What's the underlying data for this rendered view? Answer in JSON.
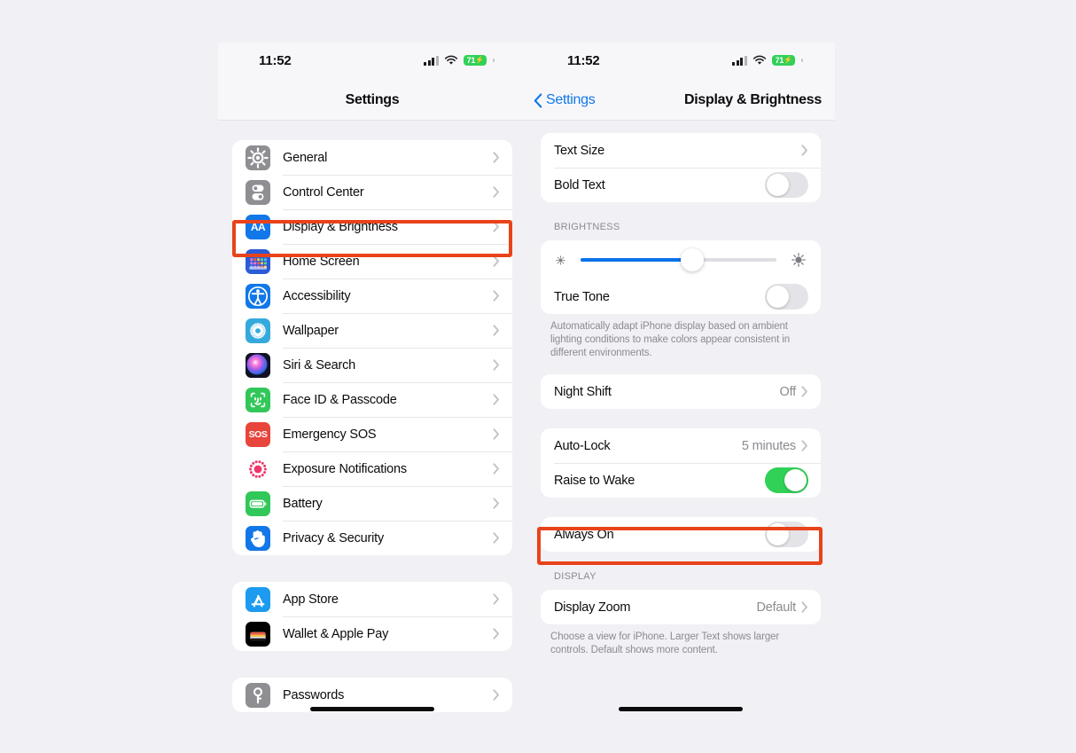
{
  "status_bar": {
    "time": "11:52",
    "battery_level": "71",
    "battery_charging_glyph": "⚡",
    "signal_icon": "cellular-bars-icon",
    "wifi_icon": "wifi-icon",
    "battery_icon": "battery-icon"
  },
  "left_panel": {
    "nav_title": "Settings",
    "groups": [
      {
        "rows": [
          {
            "label": "General",
            "icon": "gear-icon",
            "icon_bg": "#8E8E93",
            "accessory": "chevron"
          },
          {
            "label": "Control Center",
            "icon": "control-center-icon",
            "icon_bg": "#8E8E93",
            "accessory": "chevron"
          },
          {
            "label": "Display & Brightness",
            "icon": "display-brightness-icon",
            "icon_bg": "#1277E8",
            "accessory": "chevron",
            "highlighted": true
          },
          {
            "label": "Home Screen",
            "icon": "home-screen-icon",
            "icon_bg": "#2B5BD7",
            "accessory": "chevron"
          },
          {
            "label": "Accessibility",
            "icon": "accessibility-icon",
            "icon_bg": "#1277E8",
            "accessory": "chevron"
          },
          {
            "label": "Wallpaper",
            "icon": "wallpaper-icon",
            "icon_bg": "#34AADC",
            "accessory": "chevron"
          },
          {
            "label": "Siri & Search",
            "icon": "siri-icon",
            "icon_bg": "#1B1B2E",
            "accessory": "chevron"
          },
          {
            "label": "Face ID & Passcode",
            "icon": "face-id-icon",
            "icon_bg": "#31C759",
            "accessory": "chevron"
          },
          {
            "label": "Emergency SOS",
            "icon": "emergency-sos-icon",
            "icon_bg": "#E8453C",
            "accessory": "chevron"
          },
          {
            "label": "Exposure Notifications",
            "icon": "exposure-notifications-icon",
            "icon_bg": "#FFFFFF",
            "accessory": "chevron"
          },
          {
            "label": "Battery",
            "icon": "battery-settings-icon",
            "icon_bg": "#31C759",
            "accessory": "chevron"
          },
          {
            "label": "Privacy & Security",
            "icon": "privacy-hand-icon",
            "icon_bg": "#1277E8",
            "accessory": "chevron"
          }
        ]
      },
      {
        "rows": [
          {
            "label": "App Store",
            "icon": "app-store-icon",
            "icon_bg": "#1C9BF0",
            "accessory": "chevron"
          },
          {
            "label": "Wallet & Apple Pay",
            "icon": "wallet-icon",
            "icon_bg": "#000000",
            "accessory": "chevron"
          }
        ]
      },
      {
        "rows": [
          {
            "label": "Passwords",
            "icon": "passwords-key-icon",
            "icon_bg": "#8E8E93",
            "accessory": "chevron"
          }
        ]
      }
    ]
  },
  "right_panel": {
    "back_label": "Settings",
    "back_icon": "chevron-left-icon",
    "nav_title": "Display & Brightness",
    "sections": [
      {
        "header": "",
        "footer": "",
        "rows": [
          {
            "label": "Text Size",
            "accessory": "chevron"
          },
          {
            "label": "Bold Text",
            "accessory": "toggle",
            "toggle_on": false
          }
        ]
      },
      {
        "header": "BRIGHTNESS",
        "footer": "Automatically adapt iPhone display based on ambient lighting conditions to make colors appear consistent in different environments.",
        "rows": [
          {
            "label": "",
            "accessory": "slider",
            "slider_percent": 57,
            "left_icon": "brightness-low-icon",
            "right_icon": "brightness-high-icon"
          },
          {
            "label": "True Tone",
            "accessory": "toggle",
            "toggle_on": false
          }
        ]
      },
      {
        "header": "",
        "footer": "",
        "rows": [
          {
            "label": "Night Shift",
            "value": "Off",
            "accessory": "chevron"
          }
        ]
      },
      {
        "header": "",
        "footer": "",
        "rows": [
          {
            "label": "Auto-Lock",
            "value": "5 minutes",
            "accessory": "chevron"
          },
          {
            "label": "Raise to Wake",
            "accessory": "toggle",
            "toggle_on": true
          }
        ]
      },
      {
        "header": "",
        "footer": "",
        "rows": [
          {
            "label": "Always On",
            "accessory": "toggle",
            "toggle_on": false,
            "highlighted": true
          }
        ]
      },
      {
        "header": "DISPLAY",
        "footer": "Choose a view for iPhone. Larger Text shows larger controls. Default shows more content.",
        "rows": [
          {
            "label": "Display Zoom",
            "value": "Default",
            "accessory": "chevron"
          }
        ]
      }
    ]
  },
  "annotations": {
    "highlight_color": "#E8431A",
    "highlight_targets": [
      "Display & Brightness",
      "Always On"
    ]
  }
}
